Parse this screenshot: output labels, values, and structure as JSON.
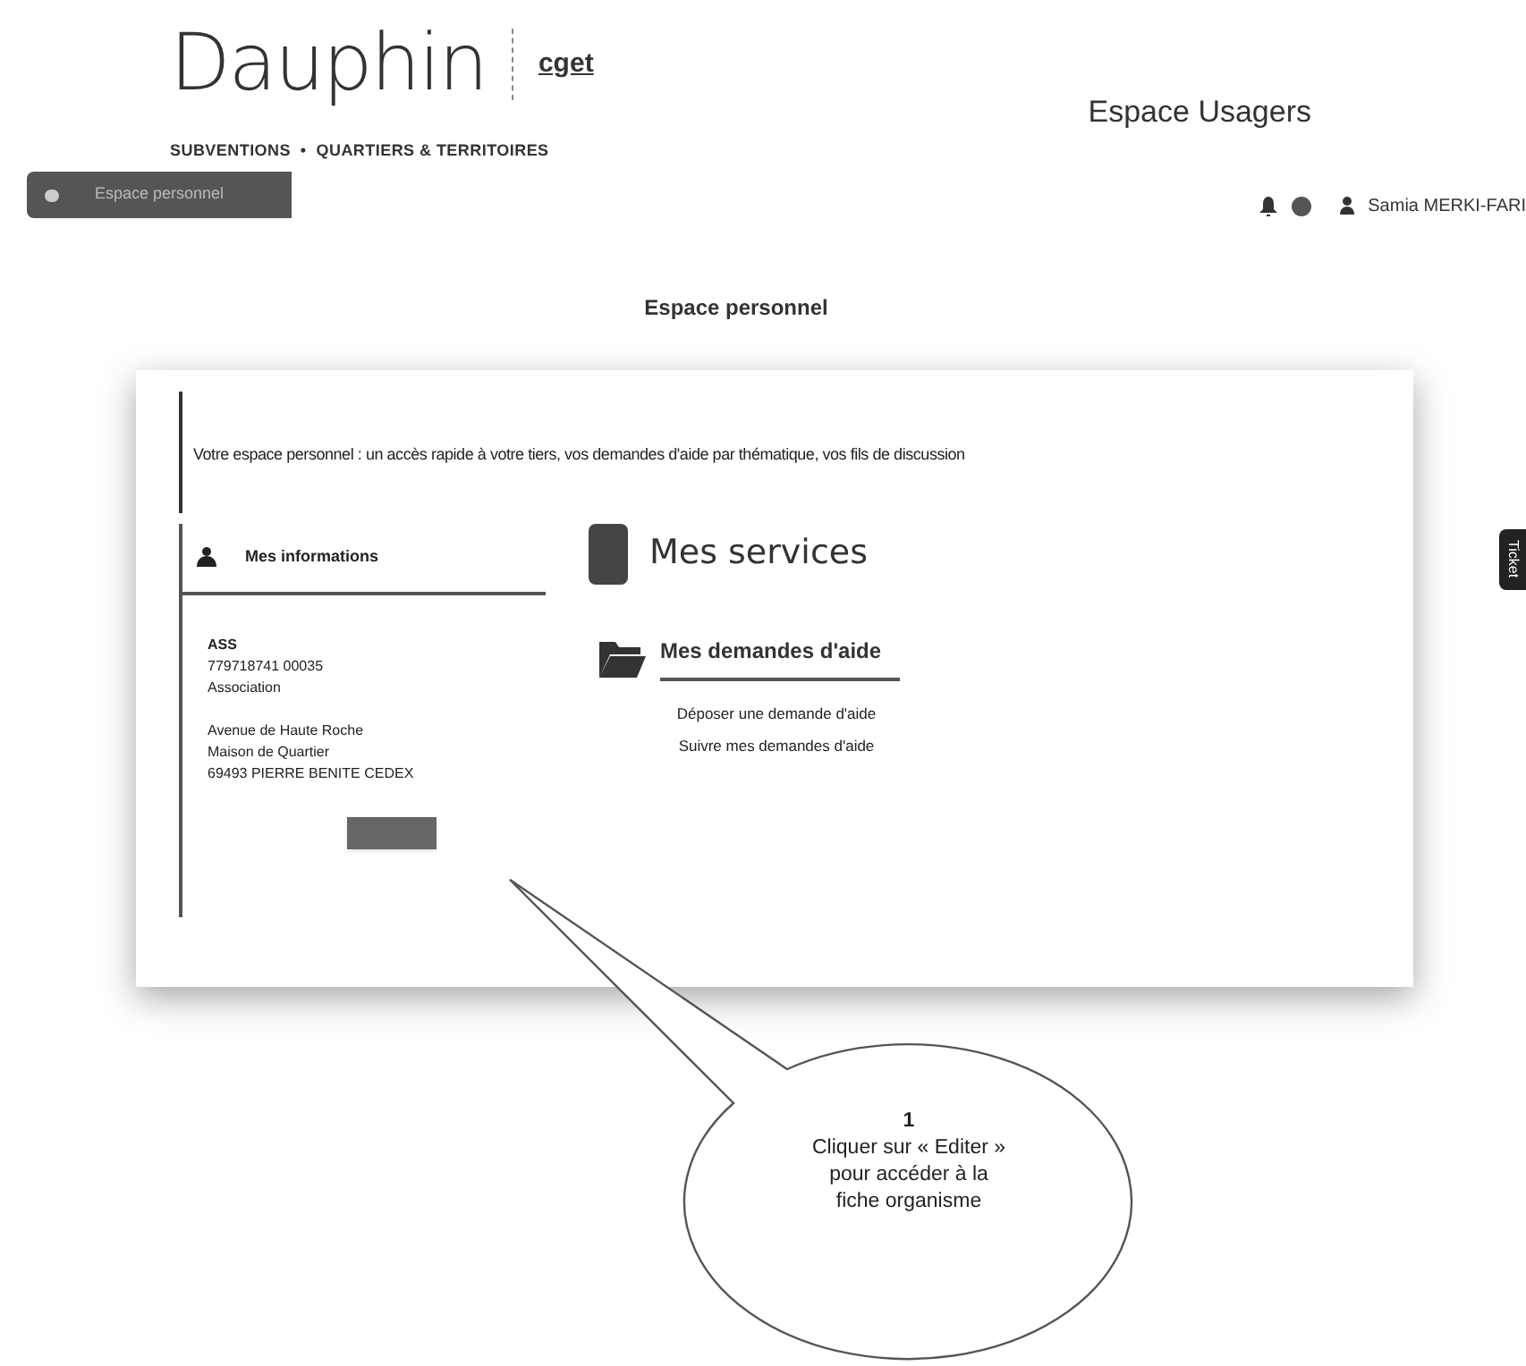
{
  "header": {
    "logo": "Dauphin",
    "partner_logo": "cget",
    "tagline": "SUBVENTIONS  •  QUARTIERS & TERRITOIRES",
    "space_title": "Espace Usagers"
  },
  "breadcrumb": {
    "label": "Espace personnel"
  },
  "user": {
    "name": "Samia MERKI-FARI"
  },
  "page_title": "Espace personnel",
  "card": {
    "intro": "Votre espace personnel : un accès rapide à votre tiers, vos demandes d'aide par thématique, vos fils de discussion",
    "info": {
      "title": "Mes informations",
      "lines": [
        "ASS",
        "779718741 00035",
        "Association"
      ],
      "address": [
        "Avenue de Haute Roche",
        "Maison de Quartier",
        "69493 PIERRE BENITE CEDEX"
      ]
    },
    "services": {
      "title": "Mes services",
      "section": "Mes demandes d'aide",
      "links": [
        "Déposer une demande d'aide",
        "Suivre mes demandes d'aide"
      ]
    }
  },
  "side_tab": {
    "label": "Ticket"
  },
  "callout": {
    "number": "1",
    "lines": [
      "Cliquer sur « Editer »",
      "pour accéder à la",
      "fiche organisme"
    ]
  }
}
